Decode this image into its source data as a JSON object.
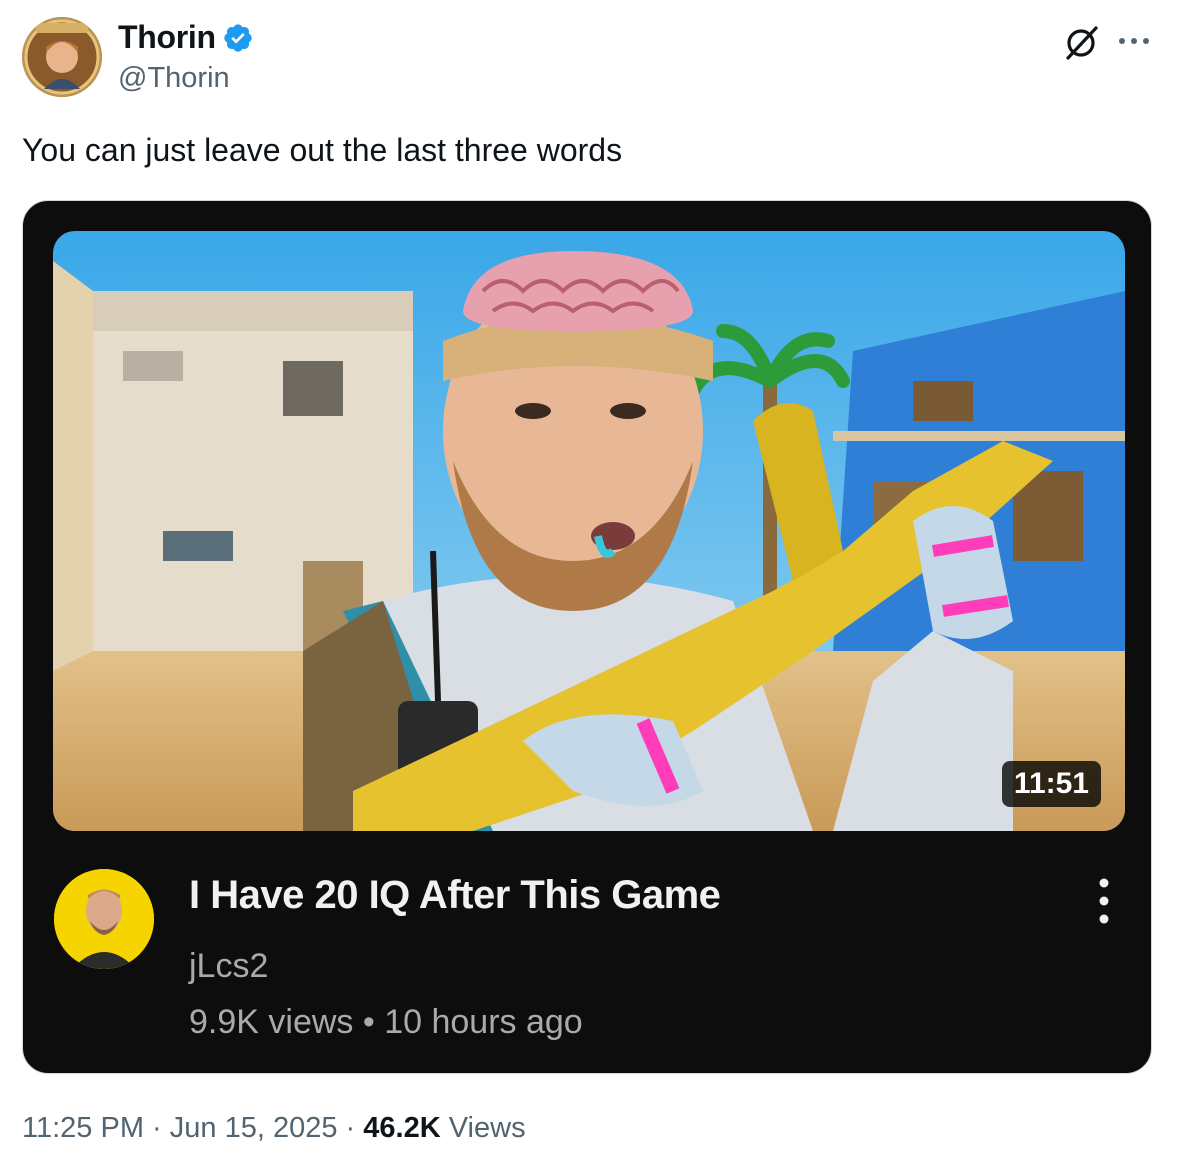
{
  "author": {
    "display_name": "Thorin",
    "handle": "@Thorin",
    "verified": true,
    "verified_color": "#1d9bf0"
  },
  "tweet": {
    "text": "You can just leave out the last three words"
  },
  "embedded_video": {
    "duration": "11:51",
    "title": "I Have 20 IQ After This Game",
    "channel": "jLcs2",
    "views": "9.9K views",
    "separator": "•",
    "age": "10 hours ago"
  },
  "footer": {
    "time": "11:25 PM",
    "date": "Jun 15, 2025",
    "dot": "·",
    "view_count": "46.2K",
    "views_label": "Views"
  },
  "icons": {
    "grok": "grok-icon",
    "more": "more-horizontal-icon",
    "verified": "verified-badge-icon",
    "video_menu": "more-vertical-icon"
  }
}
